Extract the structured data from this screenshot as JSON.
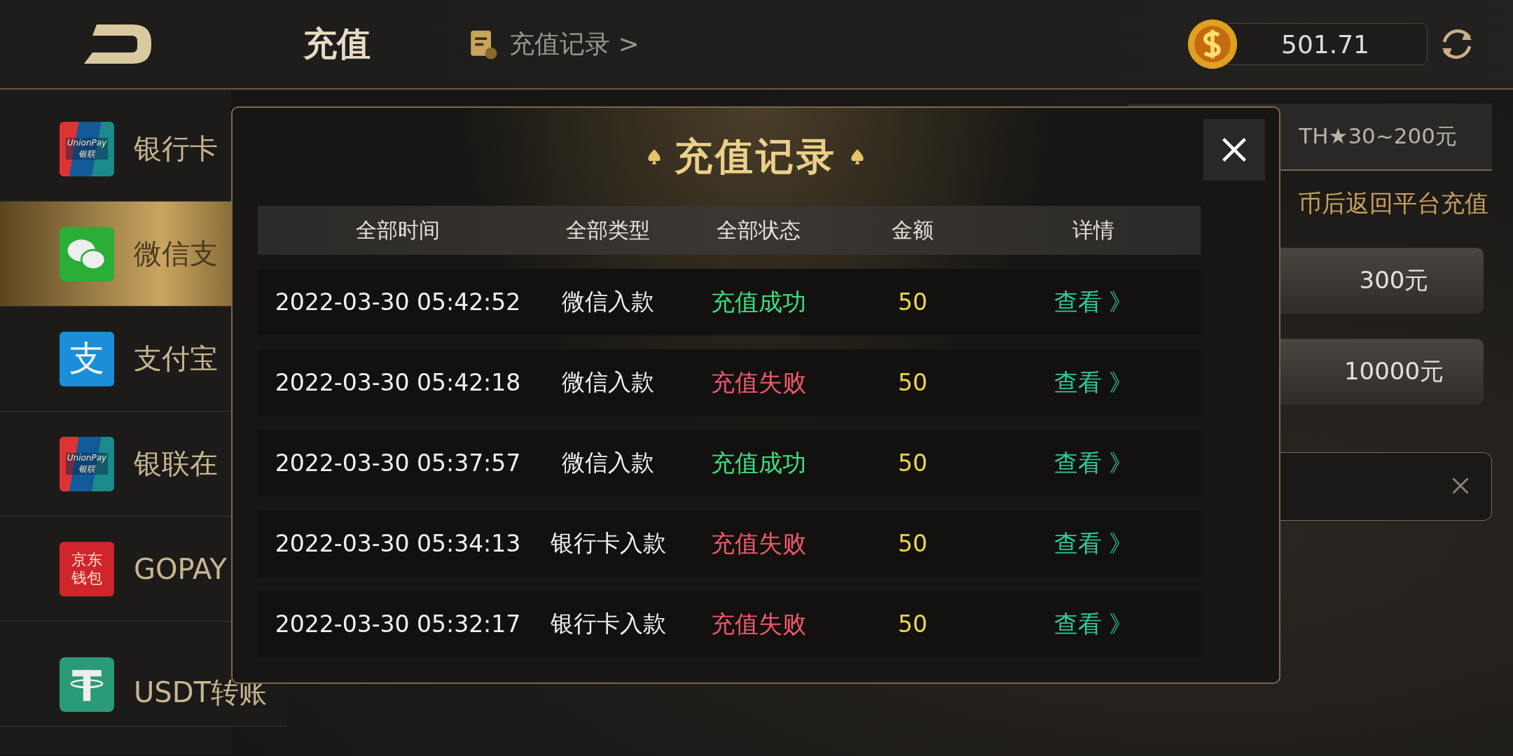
{
  "header": {
    "title": "充值",
    "record_link": "充值记录 >",
    "balance": "501.71"
  },
  "methods": [
    {
      "label": "银行卡",
      "selected": false,
      "kind": "unionpay",
      "logo_text": "UnionPay 银联"
    },
    {
      "label": "微信支",
      "selected": true,
      "kind": "wechat"
    },
    {
      "label": "支付宝",
      "selected": false,
      "kind": "alipay",
      "logo_text": "支"
    },
    {
      "label": "银联在",
      "selected": false,
      "kind": "unionpay",
      "logo_text": "UnionPay 银联"
    },
    {
      "label": "GOPAY",
      "selected": false,
      "kind": "jd",
      "logo_text": "京东钱包"
    },
    {
      "label": "USDT转账",
      "selected": false,
      "kind": "usdt"
    }
  ],
  "panel": {
    "range_chip": "TH★30~200元",
    "hint": "币后返回平台充值",
    "amount_buttons": [
      "300元",
      "10000元"
    ]
  },
  "modal": {
    "title": "充值记录",
    "columns": [
      "全部时间",
      "全部类型",
      "全部状态",
      "金额",
      "详情"
    ],
    "rows": [
      {
        "time": "2022-03-30 05:42:52",
        "type": "微信入款",
        "status": "充值成功",
        "kind": "success",
        "amount": "50",
        "action": "查看 》"
      },
      {
        "time": "2022-03-30 05:42:18",
        "type": "微信入款",
        "status": "充值失败",
        "kind": "fail",
        "amount": "50",
        "action": "查看 》"
      },
      {
        "time": "2022-03-30 05:37:57",
        "type": "微信入款",
        "status": "充值成功",
        "kind": "success",
        "amount": "50",
        "action": "查看 》"
      },
      {
        "time": "2022-03-30 05:34:13",
        "type": "银行卡入款",
        "status": "充值失败",
        "kind": "fail",
        "amount": "50",
        "action": "查看 》"
      },
      {
        "time": "2022-03-30 05:32:17",
        "type": "银行卡入款",
        "status": "充值失败",
        "kind": "fail",
        "amount": "50",
        "action": "查看 》"
      }
    ]
  }
}
